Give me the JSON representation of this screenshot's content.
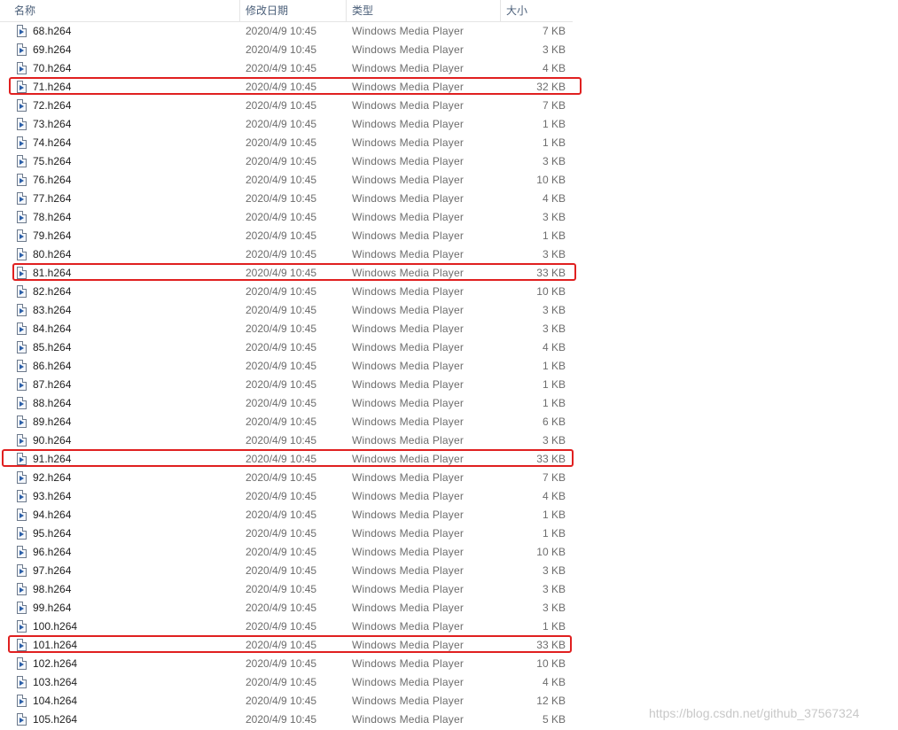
{
  "header": {
    "name": "名称",
    "date": "修改日期",
    "type": "类型",
    "size": "大小",
    "sort_indicator": "^"
  },
  "files": [
    {
      "name": "68.h264",
      "date": "2020/4/9 10:45",
      "type": "Windows Media Player",
      "size": "7 KB"
    },
    {
      "name": "69.h264",
      "date": "2020/4/9 10:45",
      "type": "Windows Media Player",
      "size": "3 KB"
    },
    {
      "name": "70.h264",
      "date": "2020/4/9 10:45",
      "type": "Windows Media Player",
      "size": "4 KB"
    },
    {
      "name": "71.h264",
      "date": "2020/4/9 10:45",
      "type": "Windows Media Player",
      "size": "32 KB",
      "highlighted": true
    },
    {
      "name": "72.h264",
      "date": "2020/4/9 10:45",
      "type": "Windows Media Player",
      "size": "7 KB"
    },
    {
      "name": "73.h264",
      "date": "2020/4/9 10:45",
      "type": "Windows Media Player",
      "size": "1 KB"
    },
    {
      "name": "74.h264",
      "date": "2020/4/9 10:45",
      "type": "Windows Media Player",
      "size": "1 KB"
    },
    {
      "name": "75.h264",
      "date": "2020/4/9 10:45",
      "type": "Windows Media Player",
      "size": "3 KB"
    },
    {
      "name": "76.h264",
      "date": "2020/4/9 10:45",
      "type": "Windows Media Player",
      "size": "10 KB"
    },
    {
      "name": "77.h264",
      "date": "2020/4/9 10:45",
      "type": "Windows Media Player",
      "size": "4 KB"
    },
    {
      "name": "78.h264",
      "date": "2020/4/9 10:45",
      "type": "Windows Media Player",
      "size": "3 KB"
    },
    {
      "name": "79.h264",
      "date": "2020/4/9 10:45",
      "type": "Windows Media Player",
      "size": "1 KB"
    },
    {
      "name": "80.h264",
      "date": "2020/4/9 10:45",
      "type": "Windows Media Player",
      "size": "3 KB"
    },
    {
      "name": "81.h264",
      "date": "2020/4/9 10:45",
      "type": "Windows Media Player",
      "size": "33 KB",
      "highlighted": true
    },
    {
      "name": "82.h264",
      "date": "2020/4/9 10:45",
      "type": "Windows Media Player",
      "size": "10 KB"
    },
    {
      "name": "83.h264",
      "date": "2020/4/9 10:45",
      "type": "Windows Media Player",
      "size": "3 KB"
    },
    {
      "name": "84.h264",
      "date": "2020/4/9 10:45",
      "type": "Windows Media Player",
      "size": "3 KB"
    },
    {
      "name": "85.h264",
      "date": "2020/4/9 10:45",
      "type": "Windows Media Player",
      "size": "4 KB"
    },
    {
      "name": "86.h264",
      "date": "2020/4/9 10:45",
      "type": "Windows Media Player",
      "size": "1 KB"
    },
    {
      "name": "87.h264",
      "date": "2020/4/9 10:45",
      "type": "Windows Media Player",
      "size": "1 KB"
    },
    {
      "name": "88.h264",
      "date": "2020/4/9 10:45",
      "type": "Windows Media Player",
      "size": "1 KB"
    },
    {
      "name": "89.h264",
      "date": "2020/4/9 10:45",
      "type": "Windows Media Player",
      "size": "6 KB"
    },
    {
      "name": "90.h264",
      "date": "2020/4/9 10:45",
      "type": "Windows Media Player",
      "size": "3 KB"
    },
    {
      "name": "91.h264",
      "date": "2020/4/9 10:45",
      "type": "Windows Media Player",
      "size": "33 KB",
      "highlighted": true
    },
    {
      "name": "92.h264",
      "date": "2020/4/9 10:45",
      "type": "Windows Media Player",
      "size": "7 KB"
    },
    {
      "name": "93.h264",
      "date": "2020/4/9 10:45",
      "type": "Windows Media Player",
      "size": "4 KB"
    },
    {
      "name": "94.h264",
      "date": "2020/4/9 10:45",
      "type": "Windows Media Player",
      "size": "1 KB"
    },
    {
      "name": "95.h264",
      "date": "2020/4/9 10:45",
      "type": "Windows Media Player",
      "size": "1 KB"
    },
    {
      "name": "96.h264",
      "date": "2020/4/9 10:45",
      "type": "Windows Media Player",
      "size": "10 KB"
    },
    {
      "name": "97.h264",
      "date": "2020/4/9 10:45",
      "type": "Windows Media Player",
      "size": "3 KB"
    },
    {
      "name": "98.h264",
      "date": "2020/4/9 10:45",
      "type": "Windows Media Player",
      "size": "3 KB"
    },
    {
      "name": "99.h264",
      "date": "2020/4/9 10:45",
      "type": "Windows Media Player",
      "size": "3 KB"
    },
    {
      "name": "100.h264",
      "date": "2020/4/9 10:45",
      "type": "Windows Media Player",
      "size": "1 KB"
    },
    {
      "name": "101.h264",
      "date": "2020/4/9 10:45",
      "type": "Windows Media Player",
      "size": "33 KB",
      "highlighted": true
    },
    {
      "name": "102.h264",
      "date": "2020/4/9 10:45",
      "type": "Windows Media Player",
      "size": "10 KB"
    },
    {
      "name": "103.h264",
      "date": "2020/4/9 10:45",
      "type": "Windows Media Player",
      "size": "4 KB"
    },
    {
      "name": "104.h264",
      "date": "2020/4/9 10:45",
      "type": "Windows Media Player",
      "size": "12 KB"
    },
    {
      "name": "105.h264",
      "date": "2020/4/9 10:45",
      "type": "Windows Media Player",
      "size": "5 KB"
    }
  ],
  "file_icon": "media-file-icon",
  "highlight_color": "#e02020",
  "watermark": "https://blog.csdn.net/github_37567324"
}
